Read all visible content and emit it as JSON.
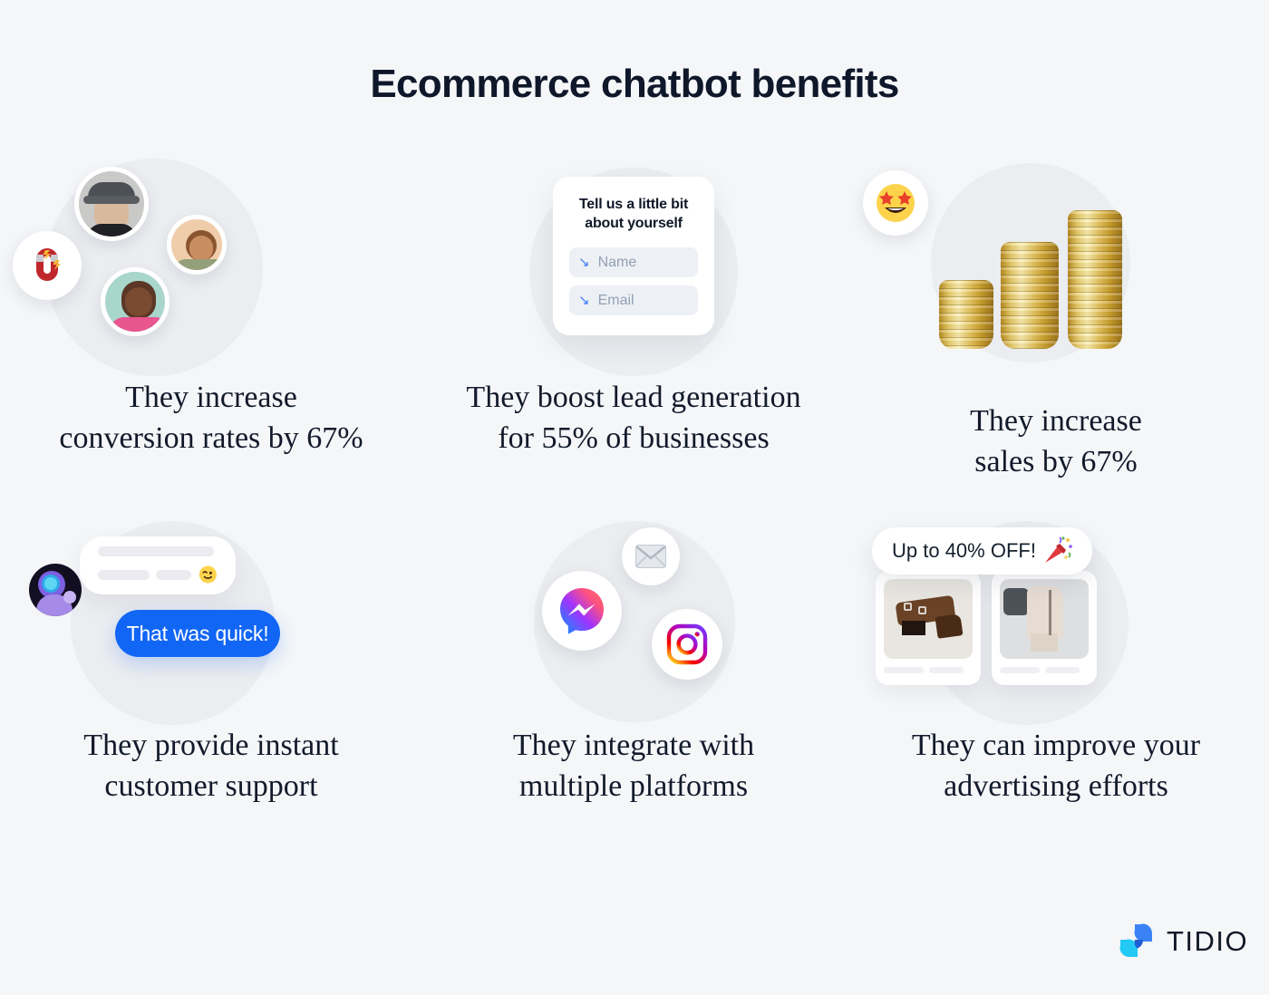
{
  "title": "Ecommerce chatbot benefits",
  "theme": {
    "page_bg": "#f4f6f8",
    "circle_bg": "#ebedf0",
    "text_dark": "#131a2b",
    "accent_blue": "#1266f5",
    "field_bg": "#edf0f5"
  },
  "benefits": [
    {
      "id": "conversion-rates",
      "caption_line1": "They increase",
      "caption_line2": "conversion rates by 67%",
      "icon": "magnet-icon"
    },
    {
      "id": "lead-generation",
      "caption_line1": "They boost lead generation",
      "caption_line2": "for 55% of businesses",
      "form": {
        "heading_line1": "Tell us a little bit",
        "heading_line2": "about yourself",
        "fields": [
          {
            "name": "name-field",
            "placeholder": "Name",
            "arrow": "↘"
          },
          {
            "name": "email-field",
            "placeholder": "Email",
            "arrow": "↘"
          }
        ]
      }
    },
    {
      "id": "sales",
      "caption_line1": "They increase",
      "caption_line2": "sales by 67%",
      "icon": "star-struck-emoji"
    },
    {
      "id": "instant-support",
      "caption_line1": "They provide instant",
      "caption_line2": "customer support",
      "chat": {
        "avatar": "robot-avatar",
        "bubble_emoji": "😉",
        "reply_text": "That was quick!"
      }
    },
    {
      "id": "multiple-platforms",
      "caption_line1": "They integrate with",
      "caption_line2": "multiple platforms",
      "platforms": [
        "email-icon",
        "messenger-icon",
        "instagram-icon"
      ]
    },
    {
      "id": "advertising",
      "caption_line1": "They can improve your",
      "caption_line2": "advertising efforts",
      "promo": {
        "text": "Up to 40% OFF!",
        "emoji": "🎉"
      },
      "products": [
        "brown-boot-thumbnail",
        "cream-boot-thumbnail"
      ]
    }
  ],
  "brand": {
    "name": "TIDIO",
    "mark": "tidio-chat-logo"
  }
}
